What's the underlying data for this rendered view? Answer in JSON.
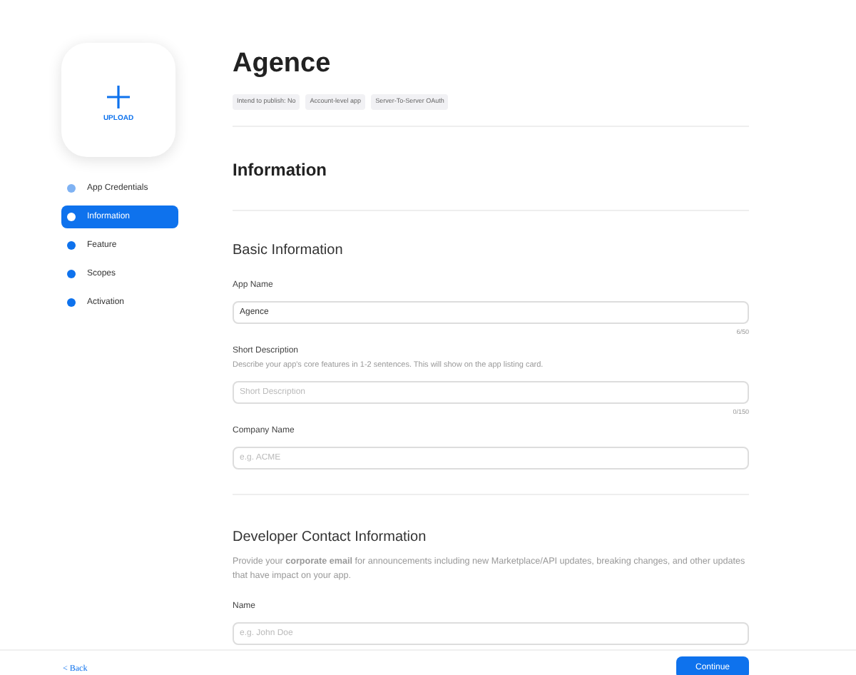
{
  "upload": {
    "label": "UPLOAD"
  },
  "steps": [
    {
      "label": "App Credentials",
      "selected": false,
      "completed": true
    },
    {
      "label": "Information",
      "selected": true,
      "completed": false
    },
    {
      "label": "Feature",
      "selected": false,
      "completed": false
    },
    {
      "label": "Scopes",
      "selected": false,
      "completed": false
    },
    {
      "label": "Activation",
      "selected": false,
      "completed": false
    }
  ],
  "app": {
    "title": "Agence",
    "tags": [
      "Intend to publish: No",
      "Account-level app",
      "Server-To-Server OAuth"
    ]
  },
  "section_title": "Information",
  "basic": {
    "heading": "Basic Information",
    "fields": [
      {
        "label": "App Name",
        "value": "Agence",
        "counter": "6/50"
      },
      {
        "label": "Short Description",
        "help": "Describe your app's core features in 1-2 sentences. This will show on the app listing card.",
        "placeholder": "Short Description",
        "counter": "0/150"
      },
      {
        "label": "Company Name",
        "placeholder": "e.g. ACME"
      }
    ]
  },
  "contact": {
    "heading": "Developer Contact Information",
    "text": "Provide your **corporate email** for announcements including new Marketplace/API updates, breaking changes, and other updates that have impact on your app.",
    "fields": [
      {
        "label": "Name",
        "placeholder": "e.g. John Doe"
      }
    ]
  },
  "footer": {
    "back": "< Back",
    "continue": "Continue"
  }
}
